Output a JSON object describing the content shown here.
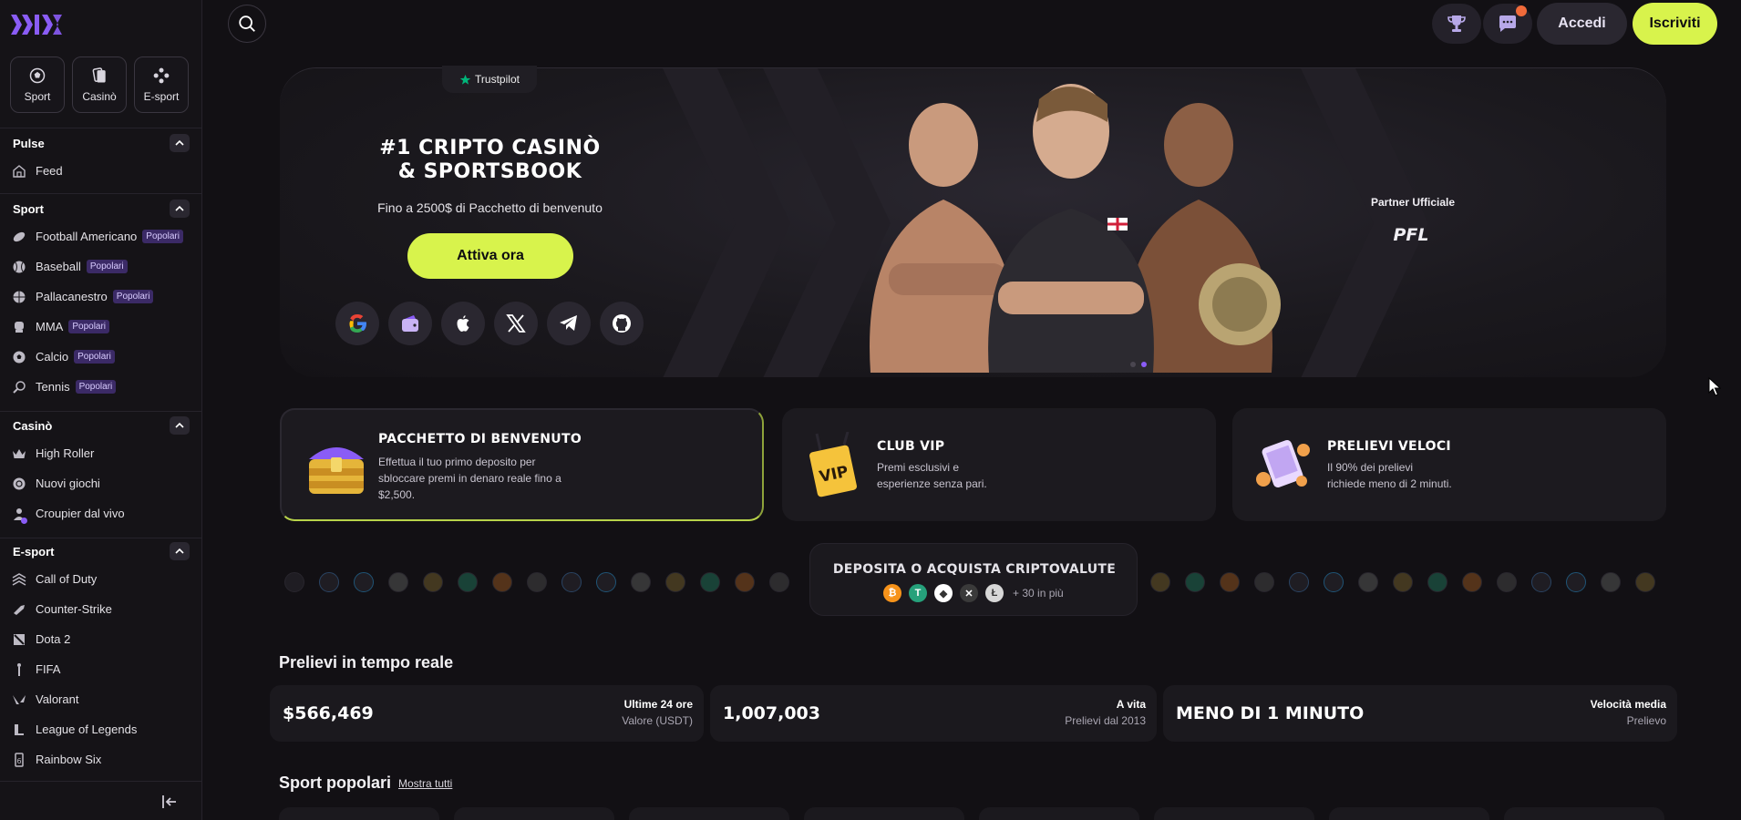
{
  "sidebar": {
    "categories": [
      {
        "label": "Sport",
        "icon": "soccer-ball-icon"
      },
      {
        "label": "Casinò",
        "icon": "cards-icon"
      },
      {
        "label": "E-sport",
        "icon": "gamepad-icon"
      }
    ],
    "pulse": {
      "title": "Pulse",
      "items": [
        {
          "label": "Feed",
          "icon": "home-icon"
        }
      ]
    },
    "sport": {
      "title": "Sport",
      "badge": "Popolari",
      "items": [
        {
          "label": "Football Americano",
          "icon": "football-icon"
        },
        {
          "label": "Baseball",
          "icon": "baseball-icon"
        },
        {
          "label": "Pallacanestro",
          "icon": "basketball-icon"
        },
        {
          "label": "MMA",
          "icon": "mma-glove-icon"
        },
        {
          "label": "Calcio",
          "icon": "soccer-icon"
        },
        {
          "label": "Tennis",
          "icon": "tennis-icon"
        }
      ]
    },
    "casino": {
      "title": "Casinò",
      "items": [
        {
          "label": "High Roller",
          "icon": "crown-icon"
        },
        {
          "label": "Nuovi giochi",
          "icon": "chip-icon"
        },
        {
          "label": "Croupier dal vivo",
          "icon": "dealer-icon"
        }
      ]
    },
    "esport": {
      "title": "E-sport",
      "items": [
        {
          "label": "Call of Duty",
          "icon": "cod-icon"
        },
        {
          "label": "Counter-Strike",
          "icon": "cs-icon"
        },
        {
          "label": "Dota 2",
          "icon": "dota-icon"
        },
        {
          "label": "FIFA",
          "icon": "fifa-icon"
        },
        {
          "label": "Valorant",
          "icon": "valorant-icon"
        },
        {
          "label": "League of Legends",
          "icon": "lol-icon"
        },
        {
          "label": "Rainbow Six",
          "icon": "r6-icon"
        }
      ]
    }
  },
  "header": {
    "login_label": "Accedi",
    "signup_label": "Iscriviti"
  },
  "hero": {
    "trustpilot": "Trustpilot",
    "title_line1": "#1 CRIPTO CASINÒ",
    "title_line2": "& SPORTSBOOK",
    "subtitle": "Fino a 2500$ di Pacchetto di benvenuto",
    "cta_label": "Attiva ora",
    "partner_label": "Partner Ufficiale",
    "partner_logo": "PFL",
    "socials": [
      "google-icon",
      "wallet-icon",
      "apple-icon",
      "x-icon",
      "telegram-icon",
      "github-icon"
    ]
  },
  "promos": [
    {
      "title": "PACCHETTO DI BENVENUTO",
      "text_line1": "Effettua il tuo primo deposito per",
      "text_line2": "sbloccare premi in denaro reale fino a",
      "text_line3": "$2,500."
    },
    {
      "title": "CLUB VIP",
      "text_line1": "Premi esclusivi e",
      "text_line2": "esperienze senza pari.",
      "img_label": "VIP"
    },
    {
      "title": "PRELIEVI VELOCI",
      "text_line1": "Il 90% dei prelievi",
      "text_line2": "richiede meno di 2 minuti."
    }
  ],
  "crypto": {
    "title": "DEPOSITA O ACQUISTA CRIPTOVALUTE",
    "more": "+ 30 in più",
    "coins": [
      {
        "name": "bitcoin-icon",
        "color": "#f7931a",
        "glyph": "₿"
      },
      {
        "name": "tether-icon",
        "color": "#26a17b",
        "glyph": "T"
      },
      {
        "name": "ethereum-icon",
        "color": "#ffffff",
        "glyph": "◆"
      },
      {
        "name": "xrp-icon",
        "color": "#3a3a3a",
        "glyph": "✕"
      },
      {
        "name": "litecoin-icon",
        "color": "#d7d7d7",
        "glyph": "Ł"
      }
    ]
  },
  "withdrawals": {
    "title": "Prelievi in tempo reale",
    "stats": [
      {
        "value": "$566,469",
        "label": "Ultime 24 ore",
        "sub": "Valore (USDT)"
      },
      {
        "value": "1,007,003",
        "label": "A vita",
        "sub": "Prelievi dal 2013"
      },
      {
        "value": "MENO DI 1 MINUTO",
        "label": "Velocità media",
        "sub": "Prelievo"
      }
    ]
  },
  "popular": {
    "title": "Sport popolari",
    "show_all": "Mostra tutti"
  },
  "colors": {
    "accent": "#d8f34c",
    "purple": "#8a5cf6",
    "background": "#121014"
  }
}
